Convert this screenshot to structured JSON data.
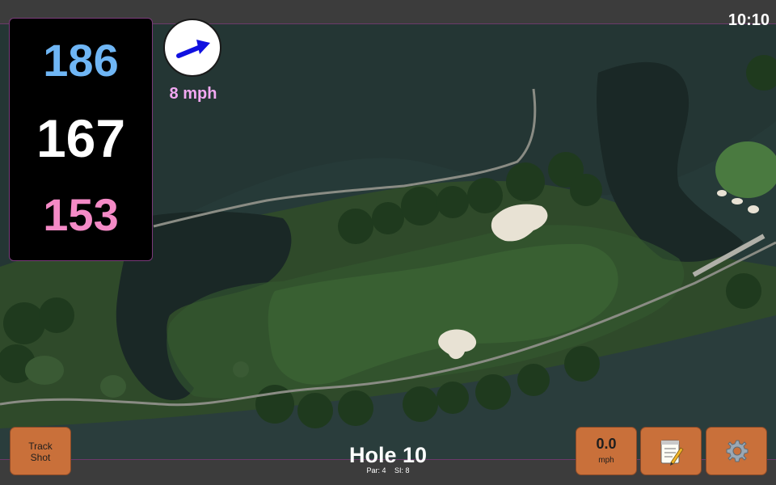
{
  "status": {
    "time": "10:10"
  },
  "distances": {
    "back": "186",
    "center": "167",
    "front": "153",
    "colors": {
      "back": "#6fb6f5",
      "center": "#ffffff",
      "front": "#f48ac6"
    }
  },
  "wind": {
    "speed_label": "8 mph",
    "arrow_color": "#1010e0"
  },
  "hole": {
    "title": "Hole 10",
    "par": "Par: 4",
    "stroke_index": "SI: 8"
  },
  "buttons": {
    "track_shot_line1": "Track",
    "track_shot_line2": "Shot",
    "speed_value": "0.0",
    "speed_unit": "mph",
    "notes_icon": "notepad-icon",
    "settings_icon": "gear-icon"
  },
  "colors": {
    "button_bg": "#c9703a",
    "panel_border": "#7a3a7a"
  }
}
